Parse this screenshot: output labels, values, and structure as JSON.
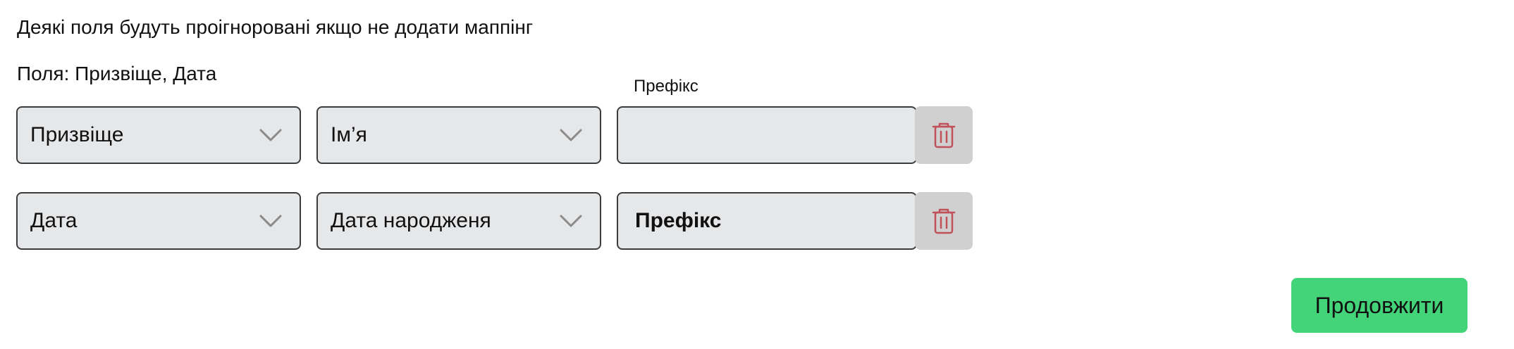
{
  "notes": {
    "warning": "Деякі поля будуть проігноровані якщо не додати маппінг",
    "fields": "Поля: Призвіще, Дата"
  },
  "columns": {
    "prefix_header": "Префікс"
  },
  "rows": [
    {
      "source_field": "Призвіще",
      "target_field": "Ім’я",
      "prefix_value": "",
      "prefix_placeholder": ""
    },
    {
      "source_field": "Дата",
      "target_field": "Дата народженя",
      "prefix_value": "Префікс",
      "prefix_placeholder": ""
    }
  ],
  "actions": {
    "continue_label": "Продовжити"
  },
  "colors": {
    "field_background": "#e6e7e9",
    "field_border": "#3c3c3c",
    "delete_button_bg": "#d0d0d0",
    "delete_icon": "#c0505a",
    "continue_button_bg": "#43d47a",
    "chevron": "#8a8a8a"
  },
  "icons": {
    "dropdown": "chevron-down-icon",
    "delete": "trash-icon"
  }
}
